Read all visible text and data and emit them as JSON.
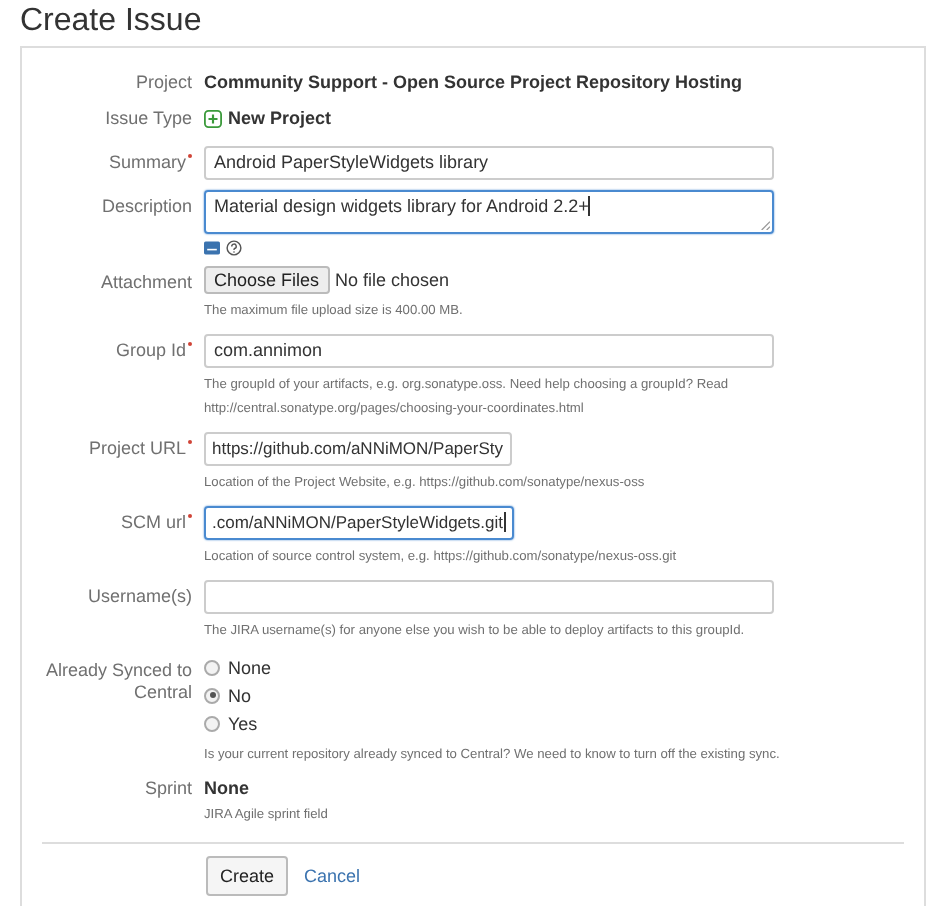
{
  "title": "Create Issue",
  "fields": [
    {
      "kind": "static",
      "label": "Project",
      "value": "Community Support - Open Source Project Repository Hosting"
    },
    {
      "kind": "issuetype",
      "label": "Issue Type",
      "value": "New Project"
    },
    {
      "kind": "input",
      "label": "Summary",
      "required": true,
      "value": "Android PaperStyleWidgets library",
      "focused": false
    },
    {
      "kind": "textarea",
      "label": "Description",
      "required": false,
      "value": "Material design widgets library for Android 2.2+",
      "focused": true
    },
    {
      "kind": "file",
      "label": "Attachment",
      "button": "Choose Files",
      "status": "No file chosen",
      "help": "The maximum file upload size is 400.00 MB."
    },
    {
      "kind": "input",
      "label": "Group Id",
      "required": true,
      "value": "com.annimon",
      "focused": false,
      "help": "The groupId of your artifacts, e.g. org.sonatype.oss. Need help choosing a groupId? Read http://central.sonatype.org/pages/choosing-your-coordinates.html"
    },
    {
      "kind": "shortinput",
      "label": "Project URL",
      "required": true,
      "value": "https://github.com/aNNiMON/PaperSty",
      "focused": false,
      "help": "Location of the Project Website, e.g. https://github.com/sonatype/nexus-oss"
    },
    {
      "kind": "shortinput",
      "label": "SCM url",
      "required": true,
      "value": ".com/aNNiMON/PaperStyleWidgets.git",
      "focused": true,
      "help": "Location of source control system, e.g. https://github.com/sonatype/nexus-oss.git"
    },
    {
      "kind": "input",
      "label": "Username(s)",
      "required": false,
      "focused": false,
      "help": "The JIRA username(s) for anyone else you wish to be able to deploy artifacts to this groupId."
    },
    {
      "kind": "radio",
      "label": "Already Synced to Central",
      "options": [
        {
          "label": "None",
          "selected": false
        },
        {
          "label": "No",
          "selected": true
        },
        {
          "label": "Yes",
          "selected": false
        }
      ],
      "help": "Is your current repository already synced to Central? We need to know to turn off the existing sync."
    },
    {
      "kind": "static",
      "label": "Sprint",
      "value": "None",
      "help": "JIRA Agile sprint field"
    }
  ],
  "buttons": {
    "create": "Create",
    "cancel": "Cancel"
  }
}
